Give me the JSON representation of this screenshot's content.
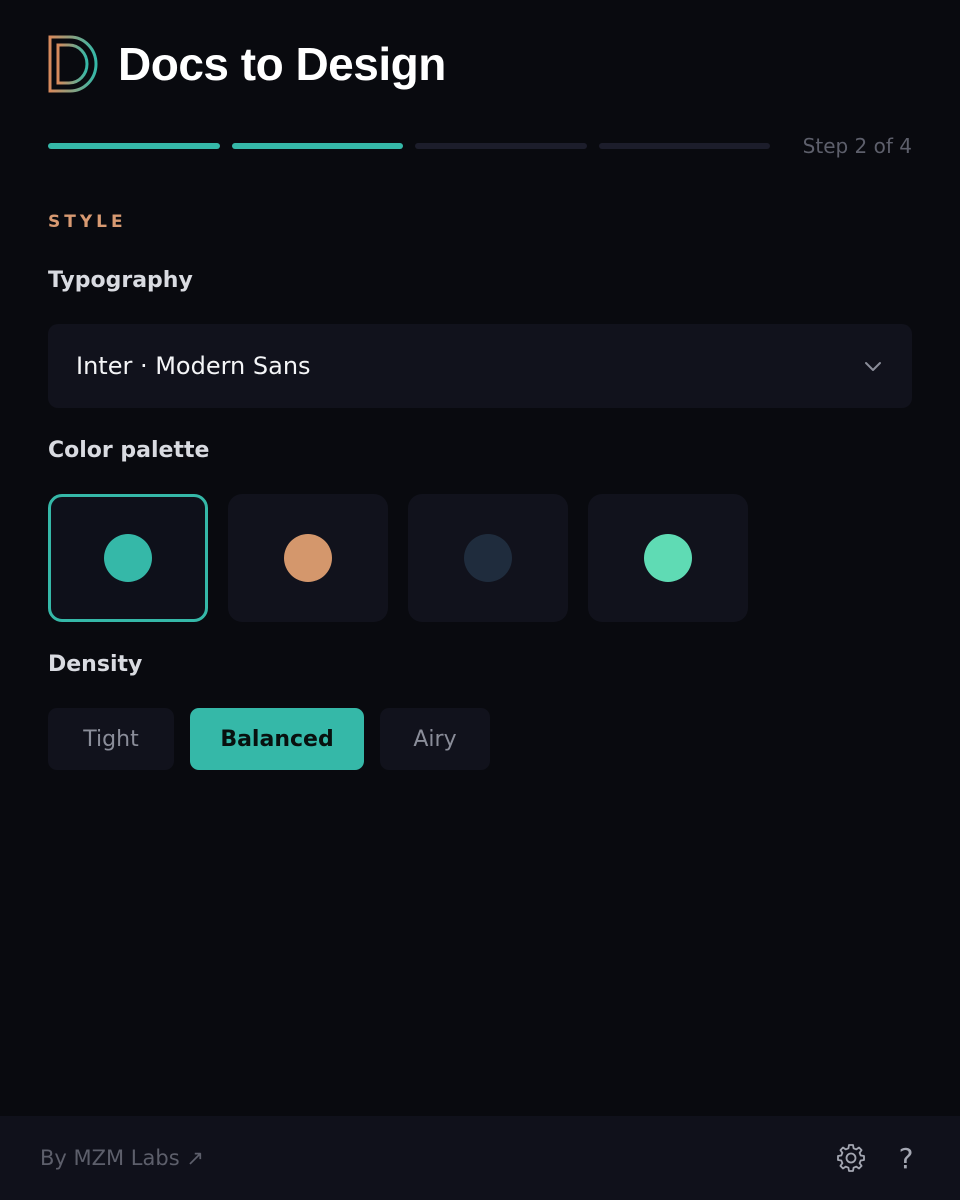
{
  "header": {
    "title": "Docs to Design",
    "logo_icon": "d-logo-icon"
  },
  "progress": {
    "current_step": 2,
    "total_steps": 4,
    "label": "Step 2 of 4"
  },
  "section": {
    "label": "STYLE"
  },
  "typography": {
    "label": "Typography",
    "selected": "Inter · Modern Sans"
  },
  "palette": {
    "label": "Color palette",
    "swatches": [
      {
        "color": "#35b8a8",
        "selected": true
      },
      {
        "color": "#d4976c",
        "selected": false
      },
      {
        "color": "#1f2c3d",
        "selected": false
      },
      {
        "color": "#5fdbb4",
        "selected": false
      }
    ]
  },
  "density": {
    "label": "Density",
    "options": [
      {
        "label": "Tight",
        "active": false
      },
      {
        "label": "Balanced",
        "active": true
      },
      {
        "label": "Airy",
        "active": false
      }
    ]
  },
  "footer": {
    "brand_link": "By MZM Labs ↗",
    "settings_icon": "gear-icon",
    "help_icon": "?"
  },
  "colors": {
    "accent": "#35b8a8",
    "section_label": "#d89a72",
    "background": "#090a0f",
    "surface": "#11121c"
  }
}
